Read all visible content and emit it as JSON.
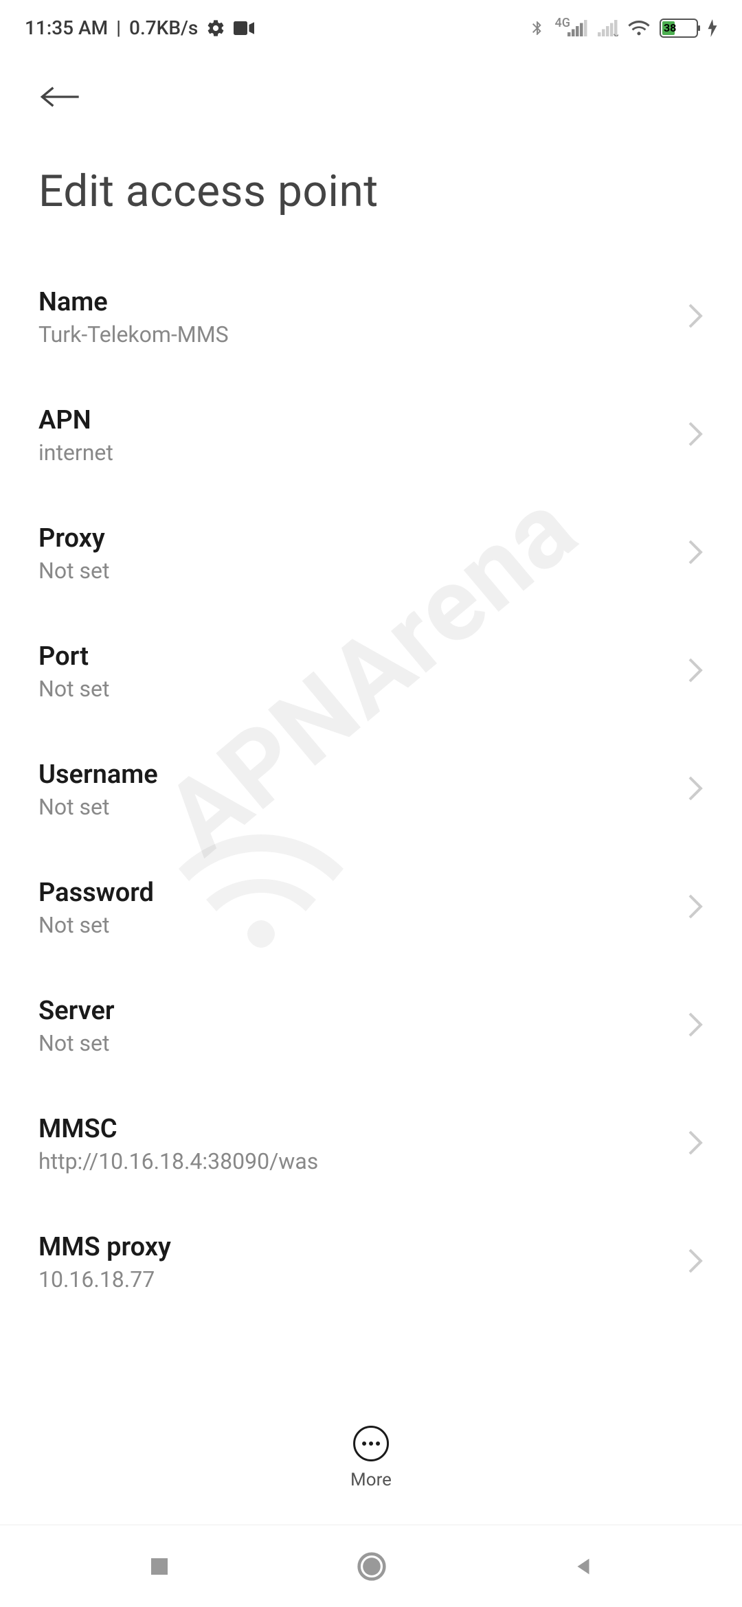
{
  "statusBar": {
    "time": "11:35 AM",
    "dataRate": "0.7KB/s",
    "networkType": "4G",
    "batteryPercent": "38"
  },
  "page": {
    "title": "Edit access point"
  },
  "settings": [
    {
      "label": "Name",
      "value": "Turk-Telekom-MMS"
    },
    {
      "label": "APN",
      "value": "internet"
    },
    {
      "label": "Proxy",
      "value": "Not set"
    },
    {
      "label": "Port",
      "value": "Not set"
    },
    {
      "label": "Username",
      "value": "Not set"
    },
    {
      "label": "Password",
      "value": "Not set"
    },
    {
      "label": "Server",
      "value": "Not set"
    },
    {
      "label": "MMSC",
      "value": "http://10.16.18.4:38090/was"
    },
    {
      "label": "MMS proxy",
      "value": "10.16.18.77"
    }
  ],
  "more": {
    "label": "More"
  },
  "watermark": "APNArena"
}
